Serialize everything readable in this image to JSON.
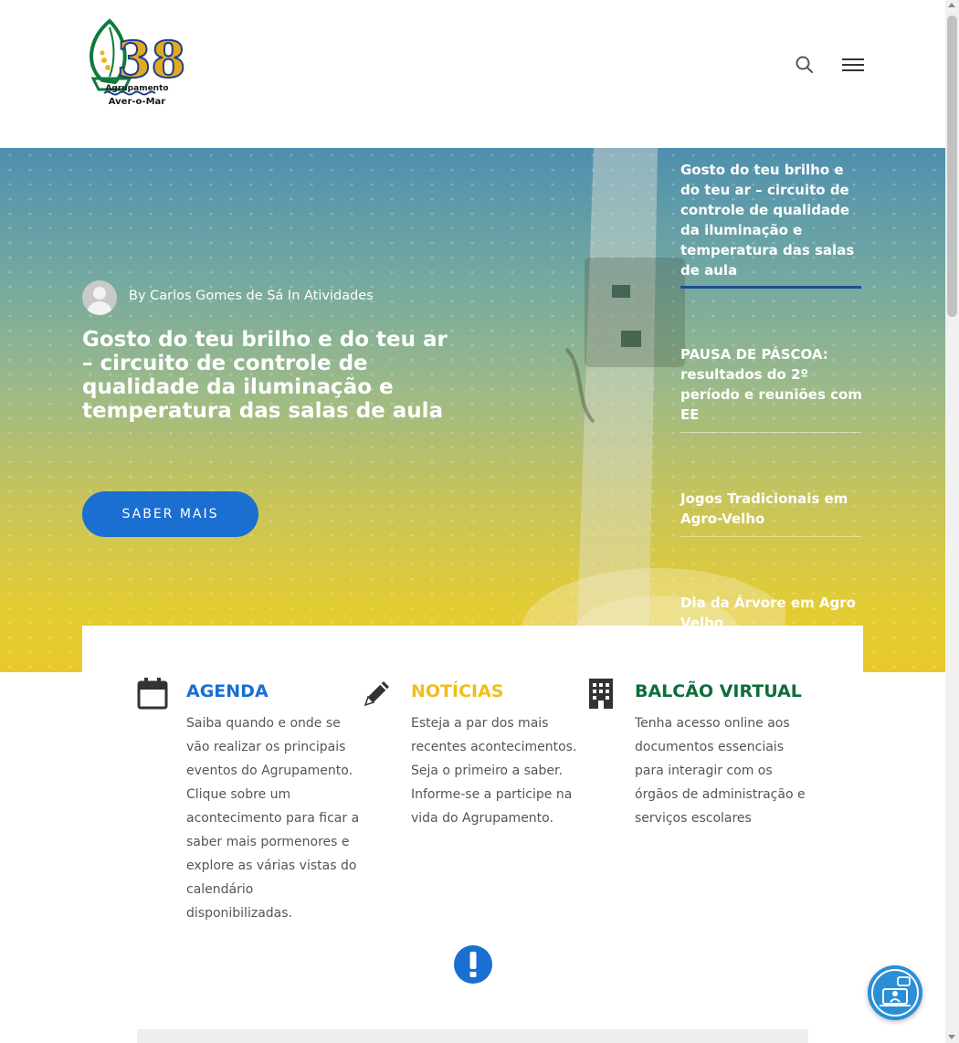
{
  "header": {
    "logo_number": "38",
    "logo_line1": "Agrupamento",
    "logo_line2": "Aver-o-Mar"
  },
  "hero": {
    "author_line": "By Carlos Gomes de Sá In Atividades",
    "title": "Gosto do teu brilho e do teu ar – circuito de controle de qualidade da iluminação e temperatura das salas de aula",
    "cta_label": "SABER MAIS",
    "cta_color": "#1a6fd0"
  },
  "posts": [
    {
      "title": "Gosto do teu brilho e do teu ar – circuito de controle de qualidade da iluminação e temperatura das salas de aula",
      "active": true
    },
    {
      "title": "PAUSA DE PÁSCOA: resultados do 2º período e reuniões com EE",
      "active": false
    },
    {
      "title": "Jogos Tradicionais em Agro-Velho",
      "active": false
    },
    {
      "title": "Dia da Árvore em Agro Velho",
      "active": false
    }
  ],
  "features": [
    {
      "title": "AGENDA",
      "icon": "calendar-icon",
      "color": "#1a6fd0",
      "text": "Saiba quando e onde se vão realizar os principais eventos do Agrupamento. Clique sobre um acontecimento para ficar a saber mais pormenores e explore as várias vistas do calendário disponibilizadas."
    },
    {
      "title": "NOTÍCIAS",
      "icon": "pencil-icon",
      "color": "#f0bd1c",
      "text": "Esteja a par dos mais recentes acontecimentos. Seja o primeiro a saber. Informe-se a participe na vida do Agrupamento."
    },
    {
      "title": "BALCÃO VIRTUAL",
      "icon": "building-icon",
      "color": "#0d6e3a",
      "text": "Tenha acesso online aos documentos essenciais para interagir com os órgãos de administração e serviços escolares"
    }
  ]
}
